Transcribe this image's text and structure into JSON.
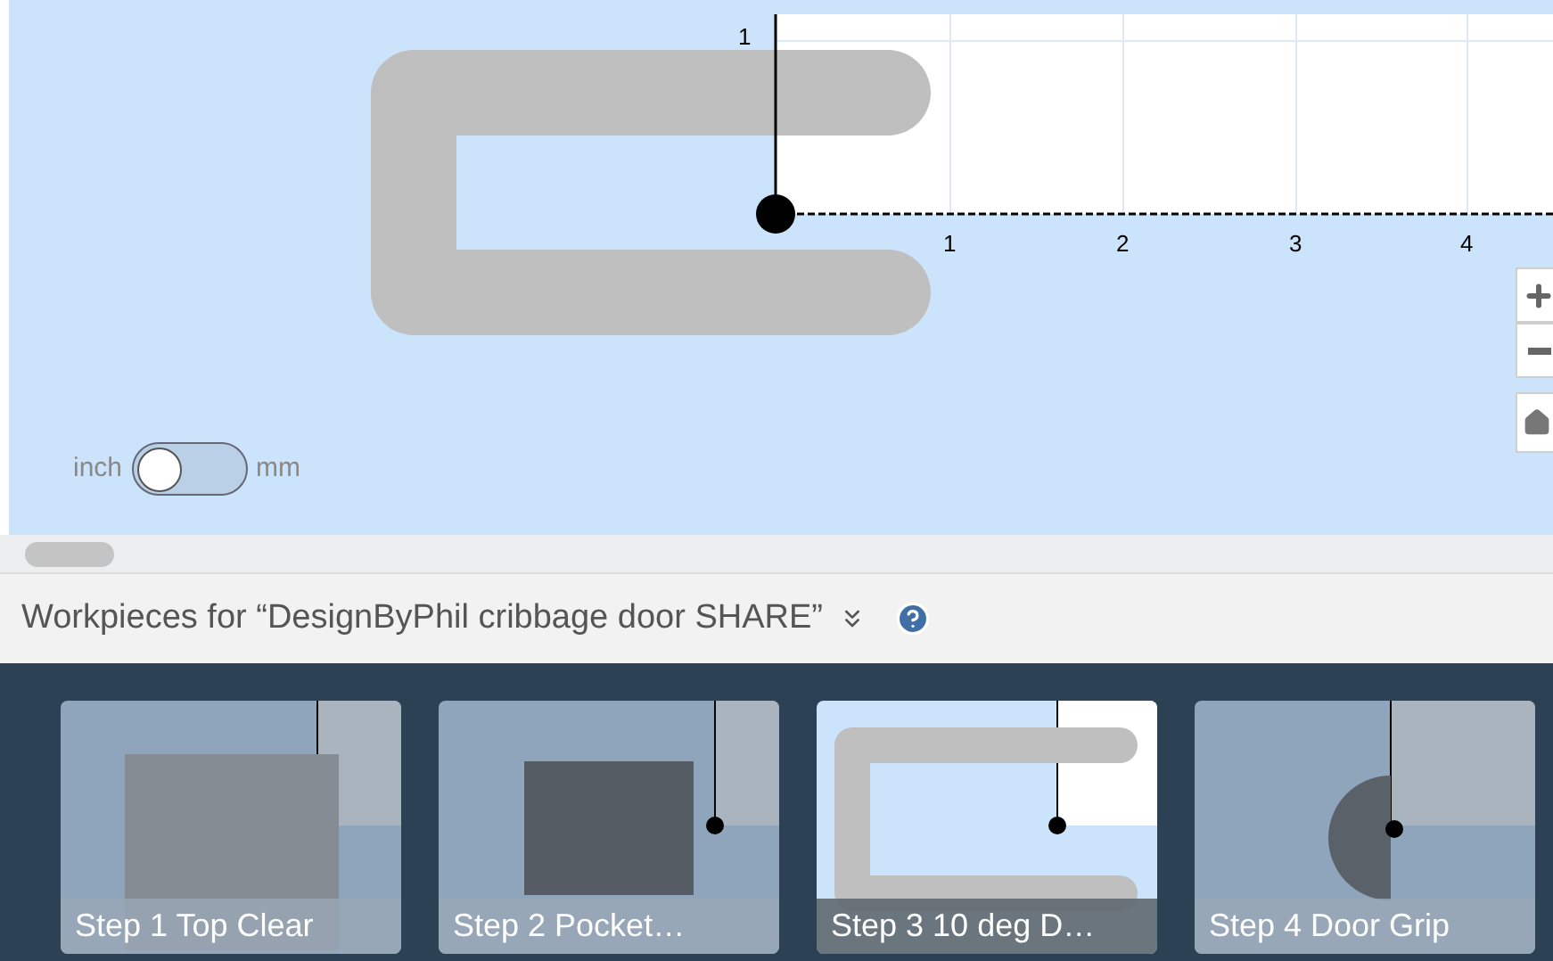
{
  "canvas": {
    "y_ticks": [
      "1"
    ],
    "x_ticks": [
      "1",
      "2",
      "3",
      "4"
    ]
  },
  "unit_toggle": {
    "left_label": "inch",
    "right_label": "mm",
    "on": false
  },
  "workpieces_header": {
    "title": "Workpieces for “DesignByPhil cribbage door SHARE”",
    "expanded": false
  },
  "workpieces": [
    {
      "label": "Step 1 Top Clear",
      "kind": "clear",
      "selected": false
    },
    {
      "label": "Step 2 Pocket…",
      "kind": "pocket",
      "selected": false
    },
    {
      "label": "Step 3 10 deg D…",
      "kind": "slot",
      "selected": true
    },
    {
      "label": "Step 4 Door Grip",
      "kind": "grip",
      "selected": false
    }
  ]
}
